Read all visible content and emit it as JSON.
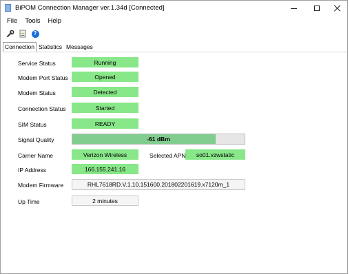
{
  "window": {
    "title": "BiPOM Connection Manager ver.1.34d [Connected]"
  },
  "menu": {
    "items": [
      "File",
      "Tools",
      "Help"
    ]
  },
  "toolbar": {
    "icons": [
      "wrench-icon",
      "document-icon",
      "help-icon"
    ],
    "help_glyph": "?"
  },
  "tabs": [
    "Connection",
    "Statistics",
    "Messages"
  ],
  "active_tab": "Connection",
  "colors": {
    "status_green": "#88e788",
    "signal_fill": "#06b025"
  },
  "connection": {
    "service_status": {
      "label": "Service Status",
      "value": "Running"
    },
    "modem_port_status": {
      "label": "Modem Port Status",
      "value": "Opened"
    },
    "modem_status": {
      "label": "Modem Status",
      "value": "Detected"
    },
    "connection_status": {
      "label": "Connection Status",
      "value": "Started"
    },
    "sim_status": {
      "label": "SIM Status",
      "value": "READY"
    },
    "signal_quality": {
      "label": "Signal Quality",
      "value": "-61 dBm",
      "level_percent": 83
    },
    "carrier_name": {
      "label": "Carrier Name",
      "value": "Verizon Wireless"
    },
    "selected_apn": {
      "label": "Selected APN",
      "value": "so01.vzwstatic"
    },
    "ip_address": {
      "label": "IP Address",
      "value": "166.155.241.16"
    },
    "modem_firmware": {
      "label": "Modem Firmware",
      "value": "RHL7618RD.V.1.10.151600.201802201619.x7120m_1"
    },
    "up_time": {
      "label": "Up Time",
      "value": "2 minutes"
    }
  }
}
